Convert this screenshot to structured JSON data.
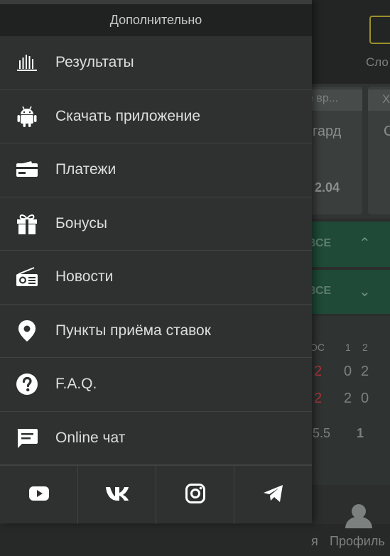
{
  "background": {
    "slots_label": "Сло",
    "card1_head": "е вр...",
    "card1_team": "гард",
    "card1_odds": "2.04",
    "card2_head": "Х",
    "card2_team": "С",
    "all_label_1": "ВСЕ",
    "all_label_2": "ВСЕ",
    "table_head": [
      "ОС",
      "1",
      "2"
    ],
    "table_row1": [
      "2",
      "0",
      "2"
    ],
    "table_row2": [
      "2",
      "2",
      "0"
    ],
    "table_row3": [
      "5.5",
      "1"
    ],
    "bottom_partial": "я",
    "profile_label": "Профиль"
  },
  "drawer": {
    "header": "Дополнительно",
    "items": [
      {
        "label": "Результаты",
        "icon": "results-bars-icon"
      },
      {
        "label": "Скачать приложение",
        "icon": "android-icon"
      },
      {
        "label": "Платежи",
        "icon": "card-icon"
      },
      {
        "label": "Бонусы",
        "icon": "gift-icon"
      },
      {
        "label": "Новости",
        "icon": "radio-icon"
      },
      {
        "label": "Пункты приёма ставок",
        "icon": "location-pin-icon"
      },
      {
        "label": "F.A.Q.",
        "icon": "question-icon"
      },
      {
        "label": "Online чат",
        "icon": "chat-icon"
      }
    ],
    "social": [
      "youtube-icon",
      "vk-icon",
      "instagram-icon",
      "telegram-icon"
    ]
  },
  "colors": {
    "drawer_bg": "#2e3130",
    "header_bg": "#1f2221",
    "text": "#dcdfdd",
    "accent_green": "#1e4a37"
  }
}
